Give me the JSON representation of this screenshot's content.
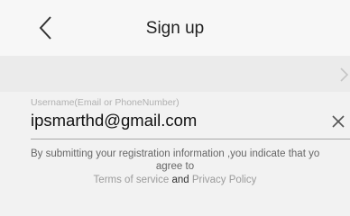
{
  "header": {
    "title": "Sign up",
    "back_icon": "chevron-left-icon"
  },
  "region_row": {
    "chevron_icon": "chevron-right-icon"
  },
  "username_field": {
    "label": "Username(Email or PhoneNumber)",
    "value": "ipsmarthd@gmail.com",
    "clear_icon": "clear-icon"
  },
  "notice": {
    "line1": "By submitting your registration information ,you indicate that yo",
    "line2": "agree to",
    "terms_link": "Terms of service",
    "and_text": "and",
    "privacy_link": "Privacy Policy"
  },
  "colors": {
    "background": "#f2f2f2",
    "row_background": "#ebebeb",
    "link": "#9b9b9b"
  }
}
